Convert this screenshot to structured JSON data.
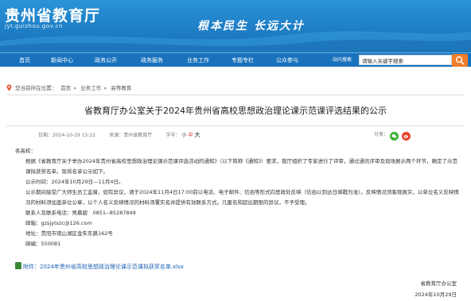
{
  "site": {
    "title": "贵州省教育厅",
    "url": "jyt.guizhou.gov.cn",
    "slogan": "根本民生 长远大计"
  },
  "nav": {
    "items": [
      "首页",
      "新闻中心",
      "政务公开",
      "政务服务",
      "业务工作",
      "专题专栏",
      "公众参与"
    ],
    "search_label": "站内搜索",
    "search_placeholder": "请输入关键字搜索"
  },
  "breadcrumb": {
    "prefix": "您当前所在位置：",
    "items": [
      "首页",
      "业务工作",
      "高等教育"
    ]
  },
  "article": {
    "title": "省教育厅办公室关于2024年贵州省高校思想政治理论课示范课评选结果的公示",
    "meta": {
      "date": "日期：2024-10-29 15:22",
      "source": "来源：贵州省教育厅",
      "fontsize_label": "字号：",
      "small": "小",
      "medium": "中",
      "large": "大",
      "share": "分享："
    },
    "greeting": "各高校：",
    "para1": "根据《省教育厅关于举办2024年贵州省高校思想政治理论课示范课评选活动的通知》（以下简称《通知》）要求，我厅组织了专家进行了评审，通过通讯评审及现场展示两个环节，确定了示范课拟获奖名单。现将名单公示如下。",
    "period": "公示时间：2024年10月29日—11月4日。",
    "para2": "公示期间接受广大师生员工监督，如有异议，请于2024年11月4日17:00前以电话、电子邮件、信函等形式向思政处反映（信函以到达日邮戳为准）。反映情况须客观真实，以单位名义反映情况的材料须加盖单位公章，以个人名义反映情况的材料须署实名并提供有效联系方式。凡匿名和超出期限的异议，不予受理。",
    "contact": "联系人及联系电话：吴晨碧　0851--85287849",
    "email": "邮箱：gzsjytszc@126.com",
    "address": "地址：贵阳市观山湖区金朱东路162号",
    "postcode": "邮编：550081",
    "attachment": "附件：2024年贵州省高校思想政治理论课示范课拟获奖名单.xlsx",
    "signer": "省教育厅办公室",
    "sign_date": "2024年10月29日"
  }
}
